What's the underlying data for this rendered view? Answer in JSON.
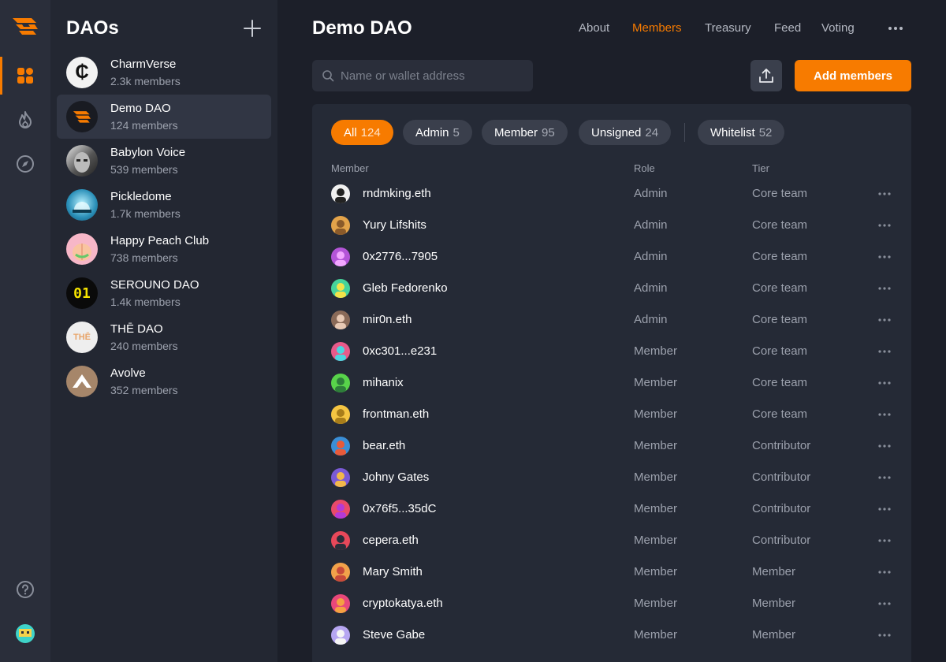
{
  "rail": {
    "items": [
      {
        "icon": "grid-icon",
        "active": true
      },
      {
        "icon": "fire-icon",
        "active": false
      },
      {
        "icon": "compass-icon",
        "active": false
      }
    ],
    "bottom": [
      {
        "icon": "help-icon"
      }
    ]
  },
  "daos": {
    "title": "DAOs",
    "items": [
      {
        "name": "CharmVerse",
        "members": "2.3k members"
      },
      {
        "name": "Demo DAO",
        "members": "124 members"
      },
      {
        "name": "Babylon Voice",
        "members": "539 members"
      },
      {
        "name": "Pickledome",
        "members": "1.7k members"
      },
      {
        "name": "Happy Peach Club",
        "members": "738 members"
      },
      {
        "name": "SEROUNO DAO",
        "members": "1.4k members"
      },
      {
        "name": "THĒ DAO",
        "members": "240 members"
      },
      {
        "name": "Avolve",
        "members": "352 members"
      }
    ],
    "avatar_labels": {
      "charmverse": "₵",
      "serouno": "01",
      "the": "THĒ"
    }
  },
  "header": {
    "title": "Demo DAO",
    "tabs": [
      {
        "label": "About"
      },
      {
        "label": "Members"
      },
      {
        "label": "Treasury"
      },
      {
        "label": "Feed"
      },
      {
        "label": "Voting"
      }
    ],
    "active_tab": "Members"
  },
  "search": {
    "placeholder": "Name or wallet address"
  },
  "actions": {
    "add_members": "Add members"
  },
  "filters": [
    {
      "label": "All",
      "count": "124"
    },
    {
      "label": "Admin",
      "count": "5"
    },
    {
      "label": "Member",
      "count": "95"
    },
    {
      "label": "Unsigned",
      "count": "24"
    },
    {
      "label": "Whitelist",
      "count": "52"
    }
  ],
  "table": {
    "columns": {
      "member": "Member",
      "role": "Role",
      "tier": "Tier"
    },
    "rows": [
      {
        "name": "rndmking.eth",
        "role": "Admin",
        "tier": "Core team"
      },
      {
        "name": "Yury Lifshits",
        "role": "Admin",
        "tier": "Core team"
      },
      {
        "name": "0x2776...7905",
        "role": "Admin",
        "tier": "Core team"
      },
      {
        "name": "Gleb Fedorenko",
        "role": "Admin",
        "tier": "Core team"
      },
      {
        "name": "mir0n.eth",
        "role": "Admin",
        "tier": "Core team"
      },
      {
        "name": "0xc301...e231",
        "role": "Member",
        "tier": "Core team"
      },
      {
        "name": "mihanix",
        "role": "Member",
        "tier": "Core team"
      },
      {
        "name": "frontman.eth",
        "role": "Member",
        "tier": "Core team"
      },
      {
        "name": "bear.eth",
        "role": "Member",
        "tier": "Contributor"
      },
      {
        "name": "Johny Gates",
        "role": "Member",
        "tier": "Contributor"
      },
      {
        "name": "0x76f5...35dC",
        "role": "Member",
        "tier": "Contributor"
      },
      {
        "name": "cepera.eth",
        "role": "Member",
        "tier": "Contributor"
      },
      {
        "name": "Mary Smith",
        "role": "Member",
        "tier": "Member"
      },
      {
        "name": "cryptokatya.eth",
        "role": "Member",
        "tier": "Member"
      },
      {
        "name": "Steve Gabe",
        "role": "Member",
        "tier": "Member"
      }
    ]
  },
  "colors": {
    "accent": "#f77b00",
    "background": "#1c1f29",
    "rail": "#2a2e3a",
    "sidebar": "#232732",
    "panel": "#252a36"
  }
}
